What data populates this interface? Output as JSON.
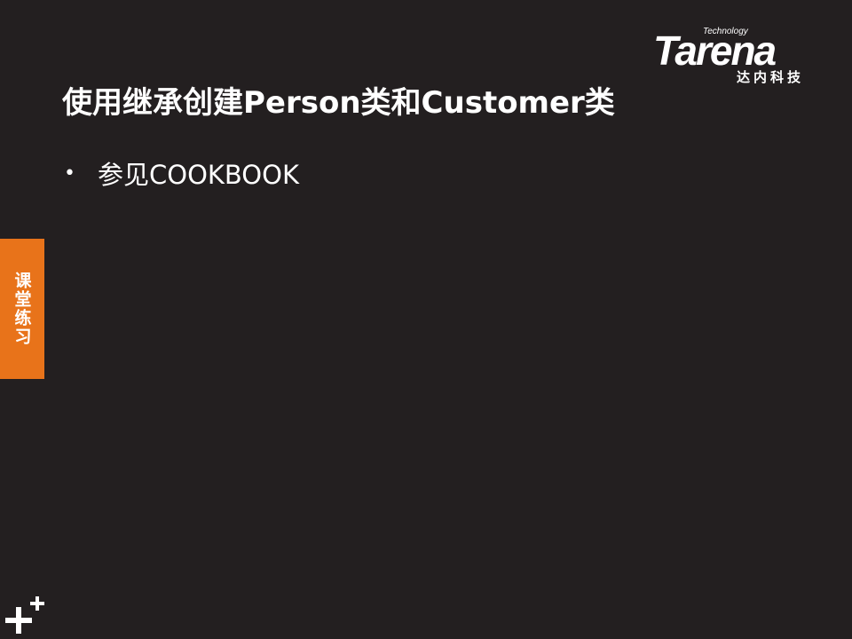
{
  "slide": {
    "title": "使用继承创建Person类和Customer类",
    "bullets": [
      {
        "text": "参见COOKBOOK"
      }
    ]
  },
  "logo": {
    "wordmark": "Tarena",
    "tagline": "Technology",
    "chinese_name": "达内科技"
  },
  "side_tab": {
    "label": "课堂练习",
    "color": "#e8731a"
  },
  "theme": {
    "background": "#231f20",
    "text": "#ffffff",
    "accent": "#e8731a"
  },
  "icons": {
    "corner_mark": "double-plus-icon"
  }
}
